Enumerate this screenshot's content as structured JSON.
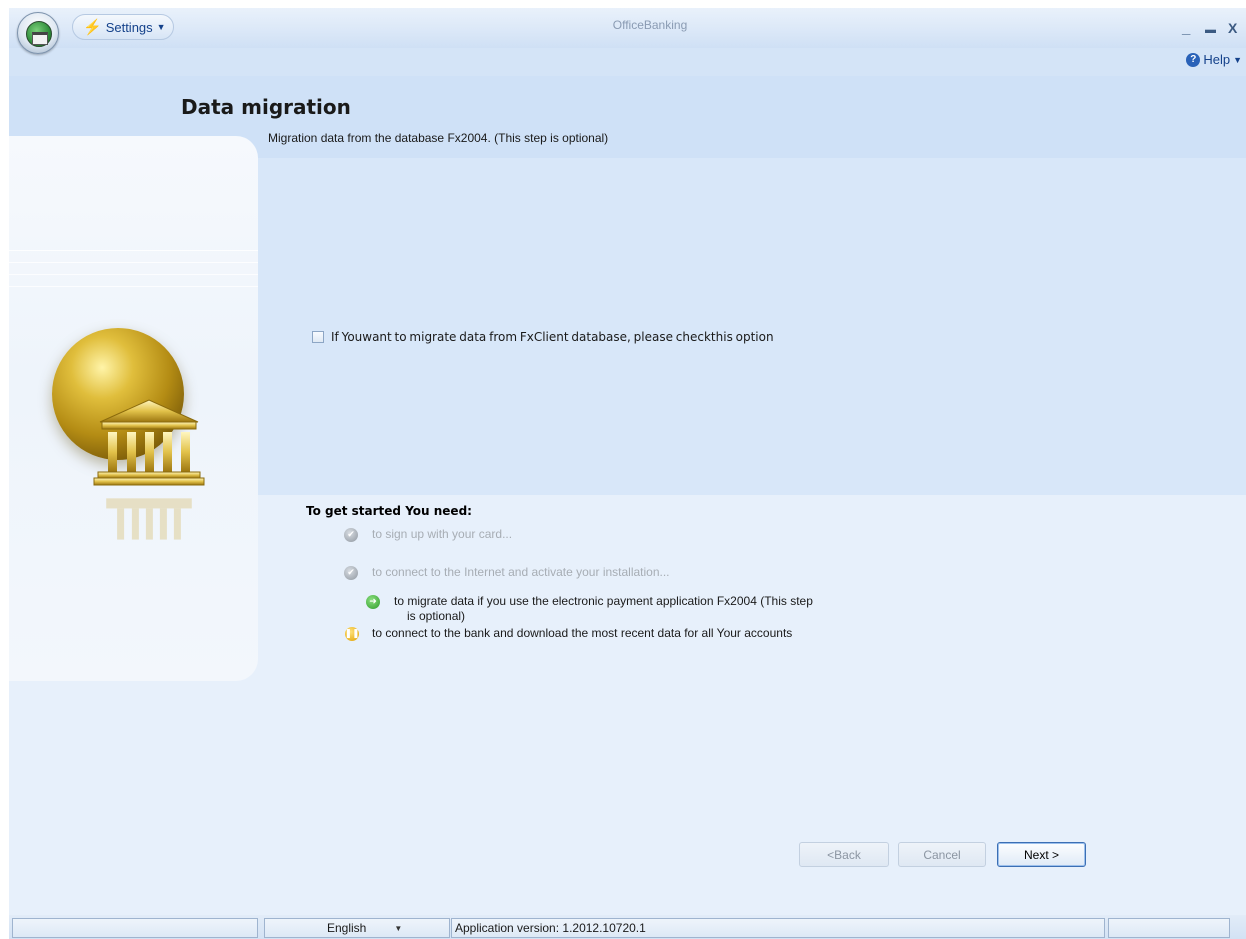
{
  "titlebar": {
    "app_title": "OfficeBanking",
    "settings_label": "Settings",
    "minimize": "_",
    "maximize": "▬",
    "close": "X"
  },
  "helpbar": {
    "help_label": "Help"
  },
  "header": {
    "title": "Data migration",
    "subtitle": "Migration data from the database Fx2004. (This step is optional)"
  },
  "migration_option": {
    "checked": false,
    "label": "If Youwant to migrate data from FxClient database, please checkthis option"
  },
  "steps": {
    "title": "To get started You need:",
    "items": [
      {
        "status": "done",
        "icon": "check-icon",
        "label": "to sign up with your card..."
      },
      {
        "status": "done",
        "icon": "check-icon",
        "label": "to connect to the Internet and activate your installation..."
      },
      {
        "status": "current",
        "icon": "arrow-right-icon",
        "label_line1": "to migrate data if you use the electronic payment application Fx2004 (This step",
        "label_line2": "is optional)"
      },
      {
        "status": "pending",
        "icon": "pause-icon",
        "label": "to connect to the bank and download the most recent data for all Your accounts"
      }
    ]
  },
  "buttons": {
    "back": "<Back",
    "cancel": "Cancel",
    "next": "Next >"
  },
  "statusbar": {
    "language": "English",
    "version": "Application version: 1.2012.10720.1"
  },
  "colors": {
    "header_bg": "#cfe1f7",
    "content_bg": "#d8e7f9",
    "accent": "#15428b",
    "gold": "#c9a227"
  }
}
